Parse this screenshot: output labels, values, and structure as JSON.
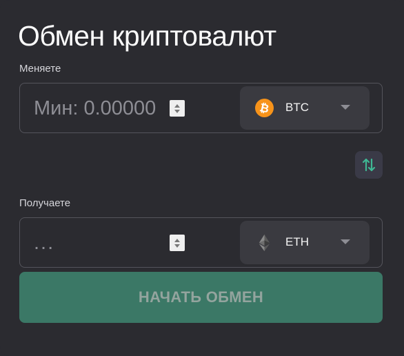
{
  "title": "Обмен криптовалют",
  "send": {
    "label": "Меняете",
    "placeholder": "Мин: 0.00000",
    "currency": "BTC",
    "icon": "bitcoin-icon",
    "icon_color": "#f7931a"
  },
  "swap": {
    "icon": "swap-vertical-arrows-icon",
    "icon_color": "#3fb894"
  },
  "receive": {
    "label": "Получаете",
    "placeholder": "...",
    "currency": "ETH",
    "icon": "ethereum-icon"
  },
  "start_button": {
    "label": "НАЧАТЬ ОБМЕН",
    "color": "#3b7866"
  },
  "colors": {
    "background": "#2b2b30",
    "selector_bg": "#3a3a40"
  }
}
